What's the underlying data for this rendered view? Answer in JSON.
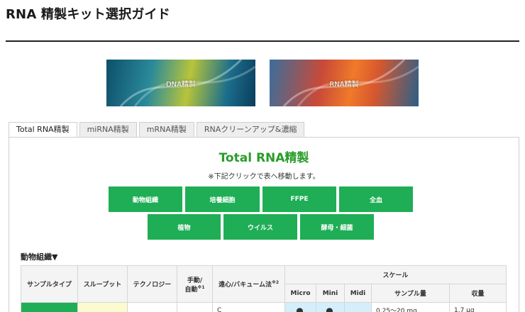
{
  "page": {
    "title": "RNA 精製キット選択ガイド"
  },
  "banners": [
    {
      "label": "DNA精製"
    },
    {
      "label": "RNA精製"
    }
  ],
  "tabs": [
    {
      "label": "Total RNA精製",
      "active": true
    },
    {
      "label": "miRNA精製",
      "active": false
    },
    {
      "label": "mRNA精製",
      "active": false
    },
    {
      "label": "RNAクリーンアップ&濃縮",
      "active": false
    }
  ],
  "panel": {
    "title": "Total RNA精製",
    "note": "※下記クリックで表へ移動します。",
    "button_color": "#1fae55",
    "title_color": "#2a9d2a"
  },
  "categories": {
    "row1": [
      "動物組織",
      "培養細胞",
      "FFPE",
      "全血"
    ],
    "row2": [
      "植物",
      "ウイルス",
      "酵母・細菌"
    ]
  },
  "section": {
    "heading": "動物組織▼"
  },
  "table": {
    "headers": {
      "sample_type": "サンプルタイプ",
      "throughput": "スループット",
      "technology": "テクノロジー",
      "manual_auto": "手動/",
      "manual_auto_2": "自動",
      "manual_auto_sup": "※1",
      "method": "遠心/バキューム法",
      "method_sup": "※2",
      "scale": "スケール",
      "micro": "Micro",
      "mini": "Mini",
      "midi": "Midi",
      "sample_amount": "サンプル量",
      "yield": "収量"
    },
    "first_row": {
      "method": "C",
      "micro": "●",
      "mini": "●",
      "sample_amount": "0.25～20 mg",
      "yield": "1.7 μg"
    }
  }
}
